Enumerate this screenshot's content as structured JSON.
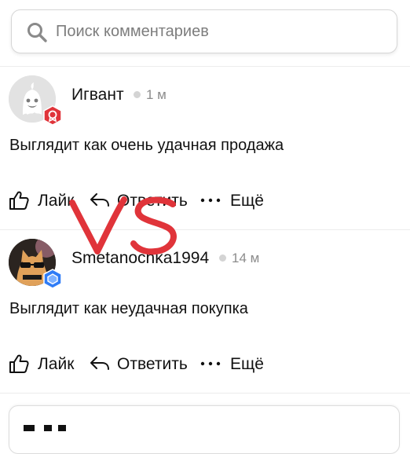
{
  "search": {
    "placeholder": "Поиск комментариев",
    "icon": "search-icon"
  },
  "comments": [
    {
      "author": "Игвант",
      "time": "1 м",
      "text": "Выглядит как очень удачная продажа",
      "badge_icon": "red-badge-icon",
      "actions": {
        "like": "Лайк",
        "reply": "Ответить",
        "more": "Ещё"
      }
    },
    {
      "author": "Smetanochka1994",
      "time": "14 м",
      "text": "Выглядит как неудачная покупка",
      "badge_icon": "blue-badge-icon",
      "actions": {
        "like": "Лайк",
        "reply": "Ответить",
        "more": "Ещё"
      }
    }
  ],
  "overlay": {
    "text": "VS",
    "color": "#e0343a"
  },
  "colors": {
    "divider": "#ececec",
    "muted": "#8c8c8c",
    "badge_red": "#e0343a",
    "badge_blue": "#2f7cf6"
  }
}
